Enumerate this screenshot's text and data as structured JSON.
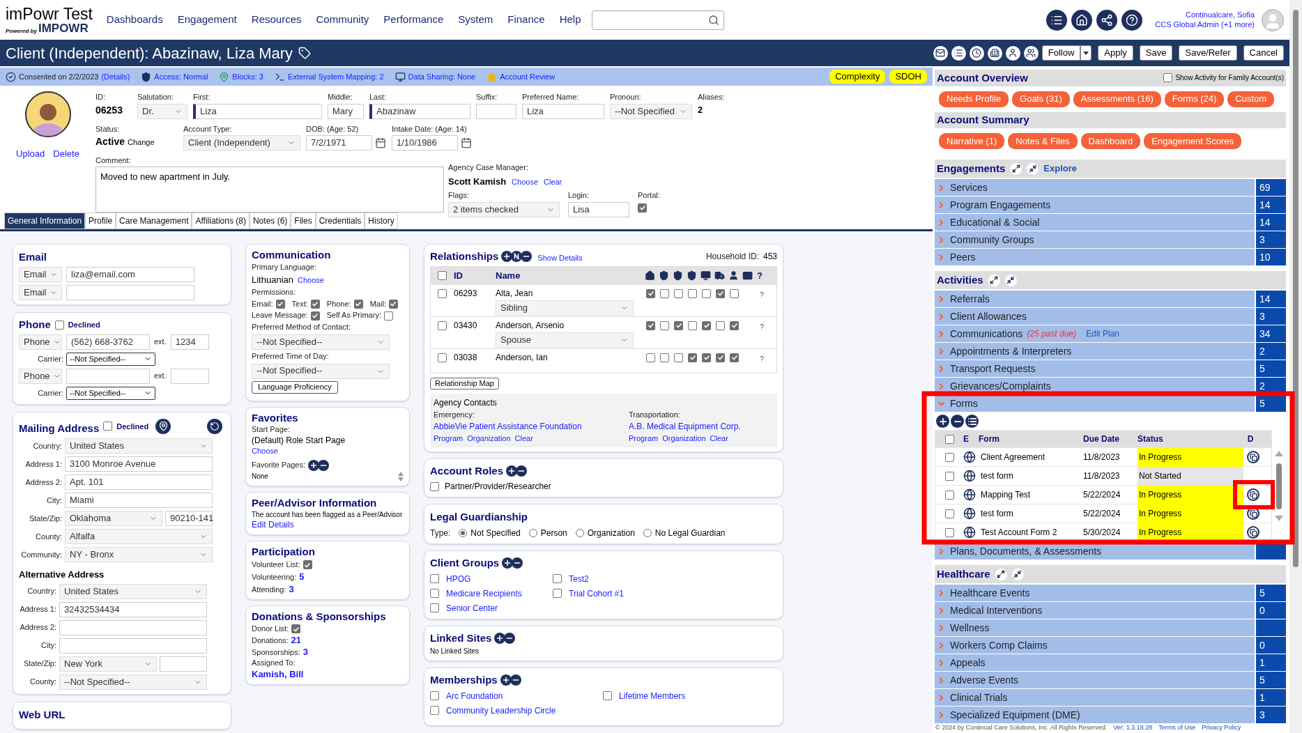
{
  "header": {
    "app_name": "imPowr Test",
    "powered_by": "Powered by",
    "brand": "IMPOWR",
    "nav": [
      "Dashboards",
      "Engagement",
      "Resources",
      "Community",
      "Performance",
      "System",
      "Finance",
      "Help"
    ],
    "user_name": "Continualcare, Sofia",
    "user_role": "CCS Global Admin (+1 more)"
  },
  "title_bar": {
    "title": "Client (Independent): Abazinaw, Liza Mary",
    "buttons": [
      {
        "label": "Follow",
        "kind": "split"
      },
      {
        "label": "Apply",
        "kind": "plain"
      },
      {
        "label": "Save",
        "kind": "plain"
      },
      {
        "label": "Save/Refer",
        "kind": "plain"
      },
      {
        "label": "Cancel",
        "kind": "plain"
      }
    ]
  },
  "info_bar": {
    "items": [
      {
        "kind": "consent",
        "text": "Consented on 2/2/2023",
        "link": "(Details)"
      },
      {
        "kind": "access",
        "text": "Access: Normal"
      },
      {
        "kind": "blocks",
        "text": "Blocks: 3"
      },
      {
        "kind": "mapping",
        "text": "External System Mapping: 2"
      },
      {
        "kind": "sharing",
        "text": "Data Sharing: None"
      },
      {
        "kind": "review",
        "text": "Account Review"
      }
    ],
    "badges": [
      "Complexity",
      "SDOH"
    ]
  },
  "client": {
    "photo_links": [
      "Upload",
      "Delete"
    ],
    "id": {
      "label": "ID:",
      "value": "06253"
    },
    "salutation": {
      "label": "Salutation:",
      "value": "Dr."
    },
    "first": {
      "label": "First:",
      "value": "Liza"
    },
    "middle": {
      "label": "Middle:",
      "value": "Mary"
    },
    "last": {
      "label": "Last:",
      "value": "Abazinaw"
    },
    "suffix": {
      "label": "Suffix:"
    },
    "preferred": {
      "label": "Preferred Name:",
      "value": "Liza"
    },
    "pronoun": {
      "label": "Pronoun:",
      "value": "--Not Specified"
    },
    "aliases": {
      "label": "Aliases:",
      "value": "2"
    },
    "status": {
      "label": "Status:",
      "value": "Active",
      "link": "Change"
    },
    "account_type": {
      "label": "Account Type:",
      "value": "Client (Independent)"
    },
    "dob": {
      "label": "DOB: (Age: 52)",
      "value": "7/2/1971"
    },
    "intake": {
      "label": "Intake Date: (Age: 14)",
      "value": "1/10/1986"
    },
    "comment": {
      "label": "Comment:",
      "value": "Moved to new apartment in July."
    },
    "case_manager": {
      "label": "Agency Case Manager:",
      "name": "Scott Kamish",
      "links": [
        "Choose",
        "Clear"
      ]
    },
    "flags": {
      "label": "Flags:",
      "value": "2 items checked"
    },
    "login": {
      "label": "Login:",
      "value": "Lisa"
    },
    "portal": {
      "label": "Portal:",
      "checked": true
    }
  },
  "tabs": [
    {
      "label": "General Information",
      "selected": true
    },
    {
      "label": "Profile",
      "selected": false
    },
    {
      "label": "Care Management",
      "selected": false
    },
    {
      "label": "Affiliations (8)",
      "selected": false
    },
    {
      "label": "Notes (6)",
      "selected": false
    },
    {
      "label": "Files",
      "selected": false
    },
    {
      "label": "Credentials",
      "selected": false
    },
    {
      "label": "History",
      "selected": false
    }
  ],
  "email": {
    "title": "Email",
    "rows": [
      {
        "type": "Email",
        "value": "liza@email.com"
      },
      {
        "type": "Email"
      }
    ]
  },
  "phone": {
    "title": "Phone",
    "declined": {
      "label": "Declined",
      "checked": false
    },
    "rows": [
      {
        "type": "Phone",
        "value": "(562) 668-3762",
        "ext_label": "ext.",
        "ext": "1234",
        "carrier_label": "Carrier:",
        "carrier": "--Not Specified--"
      },
      {
        "type": "Phone",
        "ext_label": "ext.",
        "carrier_label": "Carrier:",
        "carrier": "--Not Specified--"
      }
    ]
  },
  "mailing": {
    "title": "Mailing Address",
    "declined": {
      "label": "Declined",
      "checked": false
    },
    "fields": [
      {
        "label": "Country:",
        "value": "United States",
        "kind": "select"
      },
      {
        "label": "Address 1:",
        "value": "3100 Monroe Avenue",
        "kind": "text"
      },
      {
        "label": "Address 2:",
        "value": "Apt. 101",
        "kind": "text"
      },
      {
        "label": "City:",
        "value": "Miami",
        "kind": "text"
      },
      {
        "label": "State/Zip:",
        "value": "Oklahoma",
        "zip": "90210-141",
        "kind": "state"
      },
      {
        "label": "County:",
        "value": "Alfalfa",
        "kind": "select"
      },
      {
        "label": "Community:",
        "value": "NY - Bronx",
        "kind": "select"
      }
    ]
  },
  "alternative": {
    "title": "Alternative Address",
    "fields": [
      {
        "label": "Country:",
        "value": "United States",
        "kind": "select"
      },
      {
        "label": "Address 1:",
        "value": "32432534434",
        "kind": "text"
      },
      {
        "label": "Address 2:",
        "kind": "text"
      },
      {
        "label": "City:",
        "kind": "text"
      },
      {
        "label": "State/Zip:",
        "value": "New York",
        "kind": "state"
      },
      {
        "label": "County:",
        "value": "--Not Specified--",
        "kind": "select"
      }
    ]
  },
  "web_url": {
    "title": "Web URL"
  },
  "communication": {
    "title": "Communication",
    "language_label": "Primary Language:",
    "language": "Lithuanian",
    "choose": "Choose",
    "permissions_label": "Permissions:",
    "permissions": [
      {
        "label": "Email:",
        "checked": true
      },
      {
        "label": "Text:",
        "checked": true
      },
      {
        "label": "Phone:",
        "checked": true
      },
      {
        "label": "Mail:",
        "checked": true
      },
      {
        "label": "Leave Message:",
        "checked": true
      },
      {
        "label": "Self As Primary:",
        "checked": false
      }
    ],
    "method": {
      "label": "Preferred Method of Contact:",
      "value": "--Not Specified--"
    },
    "time": {
      "label": "Preferred Time of Day:",
      "value": "--Not Specified--"
    },
    "button": "Language Proficiency"
  },
  "favorites": {
    "title": "Favorites",
    "start_label": "Start Page:",
    "start_page": "(Default) Role Start Page",
    "choose": "Choose",
    "pages_label": "Favorite Pages:",
    "pages": "None"
  },
  "peer": {
    "title": "Peer/Advisor Information",
    "text": "The account has been flagged as a Peer/Advisor",
    "link": "Edit Details"
  },
  "participation": {
    "title": "Participation",
    "volunteer": {
      "label": "Volunteer List:",
      "checked": true
    },
    "stats": [
      {
        "label": "Volunteering:",
        "value": "5"
      },
      {
        "label": "Attending:",
        "value": "3"
      }
    ]
  },
  "donations": {
    "title": "Donations & Sponsorships",
    "donor": {
      "label": "Donor List:",
      "checked": true
    },
    "stats": [
      {
        "label": "Donations:",
        "value": "21"
      },
      {
        "label": "Sponsorships:",
        "value": "3"
      }
    ],
    "assigned_label": "Assigned To:",
    "assigned": "Kamish, Bill"
  },
  "relationships": {
    "title": "Relationships",
    "show_details": "Show Details",
    "household_label": "Household ID:",
    "household_value": "453",
    "select_all": {
      "checked": false
    },
    "columns": [
      "ID",
      "Name"
    ],
    "help_header": "?",
    "rows": [
      {
        "id": "06293",
        "name": "Alta, Jean",
        "relation": "Sibling",
        "flags": [
          true,
          false,
          false,
          false,
          false,
          true,
          false
        ],
        "help": "?",
        "checked": false
      },
      {
        "id": "03430",
        "name": "Anderson, Arsenio",
        "relation": "Spouse",
        "flags": [
          true,
          false,
          true,
          false,
          true,
          false,
          true
        ],
        "help": "?",
        "checked": false
      },
      {
        "id": "03038",
        "name": "Anderson, Ian",
        "flags": [
          false,
          false,
          false,
          true,
          true,
          true,
          true
        ],
        "help": "?",
        "checked": false
      }
    ],
    "map_button": "Relationship Map",
    "agency_title": "Agency Contacts",
    "contacts": [
      {
        "label": "Emergency:",
        "name": "AbbieVie Patient Assistance Foundation",
        "links": [
          "Program",
          "Organization",
          "Clear"
        ]
      },
      {
        "label": "Transportation:",
        "name": "A.B. Medical Equipment Corp.",
        "links": [
          "Program",
          "Organization",
          "Clear"
        ]
      }
    ]
  },
  "account_roles": {
    "title": "Account Roles",
    "items": [
      {
        "label": "Partner/Provider/Researcher",
        "checked": false
      }
    ]
  },
  "legal": {
    "title": "Legal Guardianship",
    "type_label": "Type:",
    "options": [
      {
        "label": "Not Specified",
        "selected": true
      },
      {
        "label": "Person",
        "selected": false
      },
      {
        "label": "Organization",
        "selected": false
      },
      {
        "label": "No Legal Guardian",
        "selected": false
      }
    ]
  },
  "client_groups": {
    "title": "Client Groups",
    "items": [
      {
        "label": "HPOG",
        "checked": false
      },
      {
        "label": "Test2",
        "checked": false
      },
      {
        "label": "Medicare Recipients",
        "checked": false
      },
      {
        "label": "Trial Cohort #1",
        "checked": false
      },
      {
        "label": "Senior Center",
        "checked": false
      }
    ]
  },
  "linked_sites": {
    "title": "Linked Sites",
    "text": "No Linked Sites"
  },
  "memberships": {
    "title": "Memberships",
    "items": [
      {
        "label": "Arc Foundation",
        "checked": false
      },
      {
        "label": "Lifetime Members",
        "checked": false
      },
      {
        "label": "Community Leadership Circle",
        "checked": false
      }
    ]
  },
  "right_panel": {
    "overview": {
      "title": "Account Overview",
      "family": {
        "label": "Show Activity for Family Account(s)",
        "checked": false
      },
      "buttons": [
        "Needs Profile",
        "Goals (31)",
        "Assessments (16)",
        "Forms (24)",
        "Custom"
      ]
    },
    "summary": {
      "title": "Account Summary",
      "buttons": [
        "Narrative (1)",
        "Notes & Files",
        "Dashboard",
        "Engagement Scores"
      ]
    },
    "sections": [
      {
        "title": "Engagements",
        "explore": "Explore",
        "rows": [
          {
            "label": "Services",
            "count": "69",
            "expanded": false
          },
          {
            "label": "Program Engagements",
            "count": "14",
            "expanded": false
          },
          {
            "label": "Educational & Social",
            "count": "14",
            "expanded": false
          },
          {
            "label": "Community Groups",
            "count": "3",
            "expanded": false
          },
          {
            "label": "Peers",
            "count": "10",
            "expanded": false
          }
        ]
      },
      {
        "title": "Activities",
        "rows": [
          {
            "label": "Referrals",
            "count": "14",
            "expanded": false
          },
          {
            "label": "Client Allowances",
            "count": "3",
            "expanded": false
          },
          {
            "label": "Communications",
            "note": "(25 past due)",
            "link": "Edit Plan",
            "count": "34",
            "expanded": false
          },
          {
            "label": "Appointments & Interpreters",
            "count": "2",
            "expanded": false
          },
          {
            "label": "Transport Requests",
            "count": "5",
            "expanded": false
          },
          {
            "label": "Grievances/Complaints",
            "count": "2",
            "expanded": false
          },
          {
            "label": "Forms",
            "count": "5",
            "expanded": true,
            "forms": {
              "select_all": {
                "checked": false
              },
              "columns": [
                "E",
                "Form",
                "Due Date",
                "Status",
                "D"
              ],
              "rows": [
                {
                  "form": "Client Agreement",
                  "due": "11/8/2023",
                  "status": "In Progress",
                  "kind": "in_progress",
                  "checked": false
                },
                {
                  "form": "test form",
                  "due": "11/8/2023",
                  "status": "Not Started",
                  "kind": "not_started",
                  "checked": false
                },
                {
                  "form": "Mapping Test",
                  "due": "5/22/2024",
                  "status": "In Progress",
                  "kind": "in_progress",
                  "checked": false
                },
                {
                  "form": "test form",
                  "due": "5/22/2024",
                  "status": "In Progress",
                  "kind": "in_progress",
                  "checked": false
                },
                {
                  "form": "Test Account Form 2",
                  "due": "5/30/2024",
                  "status": "In Progress",
                  "kind": "in_progress",
                  "checked": false
                }
              ]
            }
          },
          {
            "label": "Plans, Documents, & Assessments",
            "expanded": false
          }
        ]
      },
      {
        "title": "Healthcare",
        "rows": [
          {
            "label": "Healthcare Events",
            "count": "5",
            "expanded": false
          },
          {
            "label": "Medical Interventions",
            "count": "0",
            "expanded": false
          },
          {
            "label": "Wellness",
            "expanded": false
          },
          {
            "label": "Workers Comp Claims",
            "count": "0",
            "expanded": false
          },
          {
            "label": "Appeals",
            "count": "1",
            "expanded": false
          },
          {
            "label": "Adverse Events",
            "count": "5",
            "expanded": false
          },
          {
            "label": "Clinical Trials",
            "count": "1",
            "expanded": false
          },
          {
            "label": "Specialized Equipment (DME)",
            "count": "3",
            "expanded": false
          }
        ]
      }
    ]
  },
  "footer": {
    "copyright": "© 2024 by Continual Care Solutions, Inc. All Rights Reserved.",
    "version": "Ver: 1.3.18.28",
    "links": [
      "Terms of Use",
      "Privacy Policy"
    ]
  }
}
